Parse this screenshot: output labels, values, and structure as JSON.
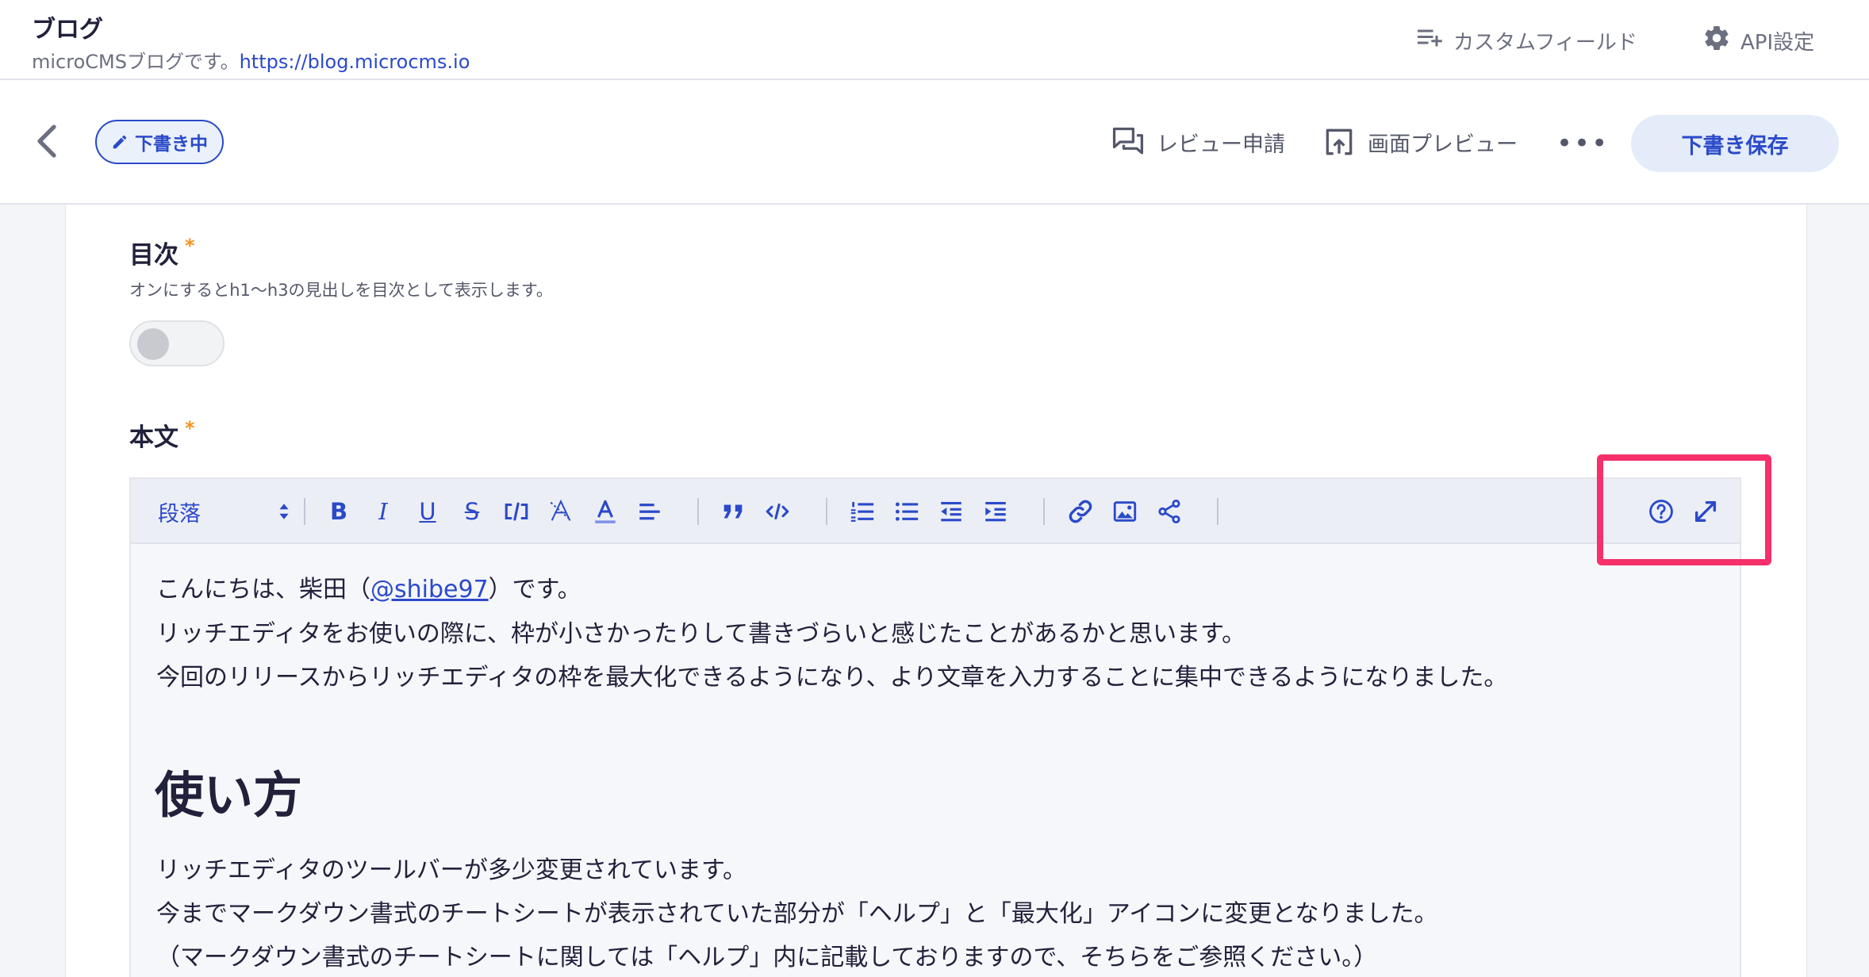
{
  "header": {
    "title": "ブログ",
    "description": "microCMSブログです。",
    "url": "https://blog.microcms.io",
    "custom_fields_label": "カスタムフィールド",
    "api_settings_label": "API設定"
  },
  "edit_bar": {
    "status_label": "下書き中",
    "review_label": "レビュー申請",
    "preview_label": "画面プレビュー",
    "more_label": "•••",
    "save_label": "下書き保存"
  },
  "fields": {
    "toc": {
      "label": "目次",
      "required_mark": "*",
      "description": "オンにするとh1〜h3の見出しを目次として表示します。",
      "toggle_on": false
    },
    "body": {
      "label": "本文",
      "required_mark": "*"
    }
  },
  "toolbar": {
    "paragraph_select_value": "段落",
    "buttons": {
      "bold": "B",
      "italic": "I",
      "underline": "U",
      "strike": "S",
      "inline_code": "<>",
      "clear_format": "A",
      "text_color": "A"
    },
    "icons": [
      "chevron-up-down-icon",
      "bold-icon",
      "italic-icon",
      "underline-icon",
      "strikethrough-icon",
      "inline-code-icon",
      "clear-format-icon",
      "text-color-icon",
      "align-icon",
      "quote-icon",
      "code-block-icon",
      "ordered-list-icon",
      "bullet-list-icon",
      "outdent-icon",
      "indent-icon",
      "link-icon",
      "image-icon",
      "embed-share-icon",
      "help-icon",
      "maximize-icon"
    ]
  },
  "editor": {
    "line1_before": "こんにちは、柴田（",
    "line1_link": "@shibe97",
    "line1_after": "）です。",
    "line2": "リッチエディタをお使いの際に、枠が小さかったりして書きづらいと感じたことがあるかと思います。",
    "line3": "今回のリリースからリッチエディタの枠を最大化できるようになり、より文章を入力することに集中できるようになりました。",
    "heading": "使い方",
    "line4": "リッチエディタのツールバーが多少変更されています。",
    "line5": "今までマークダウン書式のチートシートが表示されていた部分が「ヘルプ」と「最大化」アイコンに変更となりました。",
    "line6": "（マークダウン書式のチートシートに関しては「ヘルプ」内に記載しておりますので、そちらをご参照ください。）"
  },
  "colors": {
    "accent": "#2b4ac9",
    "required": "#f7931e",
    "highlight": "#f5306a",
    "save_button_bg": "#e3ecf8",
    "toolbar_bg": "#eceef6"
  }
}
